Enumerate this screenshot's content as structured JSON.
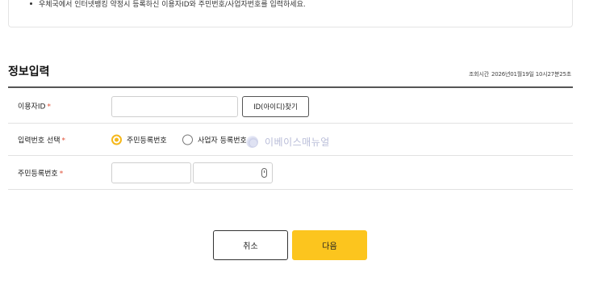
{
  "notice": {
    "text": "우체국에서 인터넷뱅킹 약정시 등록하신 이용자ID와 주민번호/사업자번호를 입력하세요."
  },
  "section": {
    "title": "정보입력",
    "time_label": "조회시간",
    "time_value": "2026년01월19일 10시27분25초"
  },
  "form": {
    "user_id": {
      "label": "이용자ID",
      "required_mark": "*",
      "value": "",
      "find_button": "ID(아이디)찾기"
    },
    "id_type": {
      "label": "입력번호 선택",
      "required_mark": "*",
      "options": [
        {
          "label": "주민등록번호",
          "checked": true
        },
        {
          "label": "사업자 등록번호",
          "checked": false
        }
      ]
    },
    "rrn": {
      "label": "주민등록번호",
      "required_mark": "*",
      "front_value": "",
      "back_value": "",
      "keypad_icon": "secure-keypad-icon"
    }
  },
  "watermark": {
    "text": "이베이스매뉴얼"
  },
  "buttons": {
    "cancel": "취소",
    "next": "다음"
  },
  "colors": {
    "accent": "#fcc51e",
    "radio_checked": "#f5b81c",
    "required": "#e0533a"
  }
}
